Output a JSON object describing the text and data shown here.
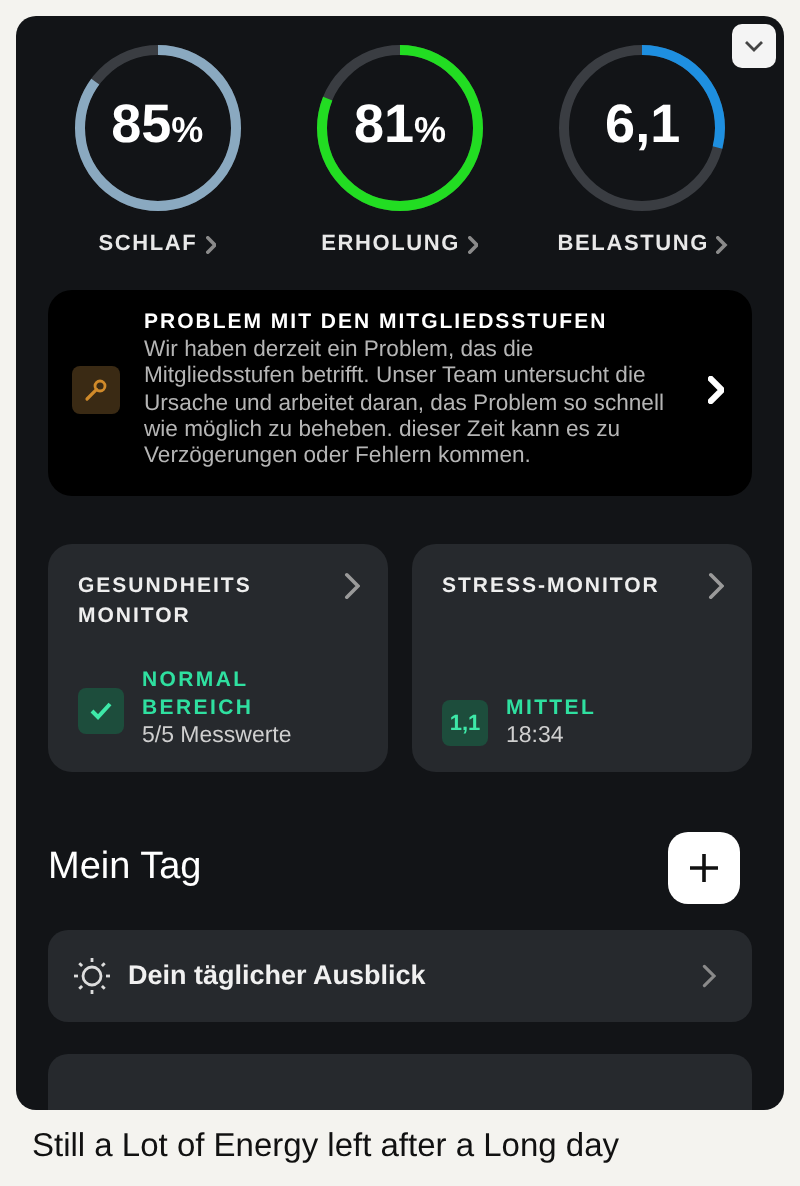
{
  "rings": [
    {
      "value": "85",
      "unit": "%",
      "label": "SCHLAF",
      "level": 0.85,
      "color": "#8aa9c0"
    },
    {
      "value": "81",
      "unit": "%",
      "label": "ERHOLUNG",
      "level": 0.81,
      "color": "#22dd22"
    },
    {
      "value": "6,1",
      "label": "BELASTUNG",
      "level": 0.29,
      "color": "#1e8fe0"
    }
  ],
  "alert": {
    "title": "PROBLEM MIT DEN MITGLIEDSSTUFEN",
    "body": "Wir haben derzeit ein Problem, das die Mitgliedsstufen betrifft. Unser Team untersucht die Ursache und arbeitet daran, das Problem so schnell wie möglich zu beheben. dieser Zeit kann es zu Verzögerungen oder Fehlern kommen."
  },
  "monitors": [
    {
      "title": "GESUNDHEITS MONITOR",
      "kind": "check",
      "status": "NORMAL BEREICH",
      "detail": "5/5 Messwerte"
    },
    {
      "title": "STRESS-MONITOR",
      "kind": "score",
      "badge": "1,1",
      "status": "MITTEL",
      "detail": "18:34"
    }
  ],
  "section": {
    "title": "Mein Tag"
  },
  "rows": [
    {
      "kind": "outlook",
      "label": "Dein täglicher Ausblick"
    },
    {
      "kind": "blank"
    }
  ],
  "caption": "Still a Lot of Energy left after a Long day"
}
